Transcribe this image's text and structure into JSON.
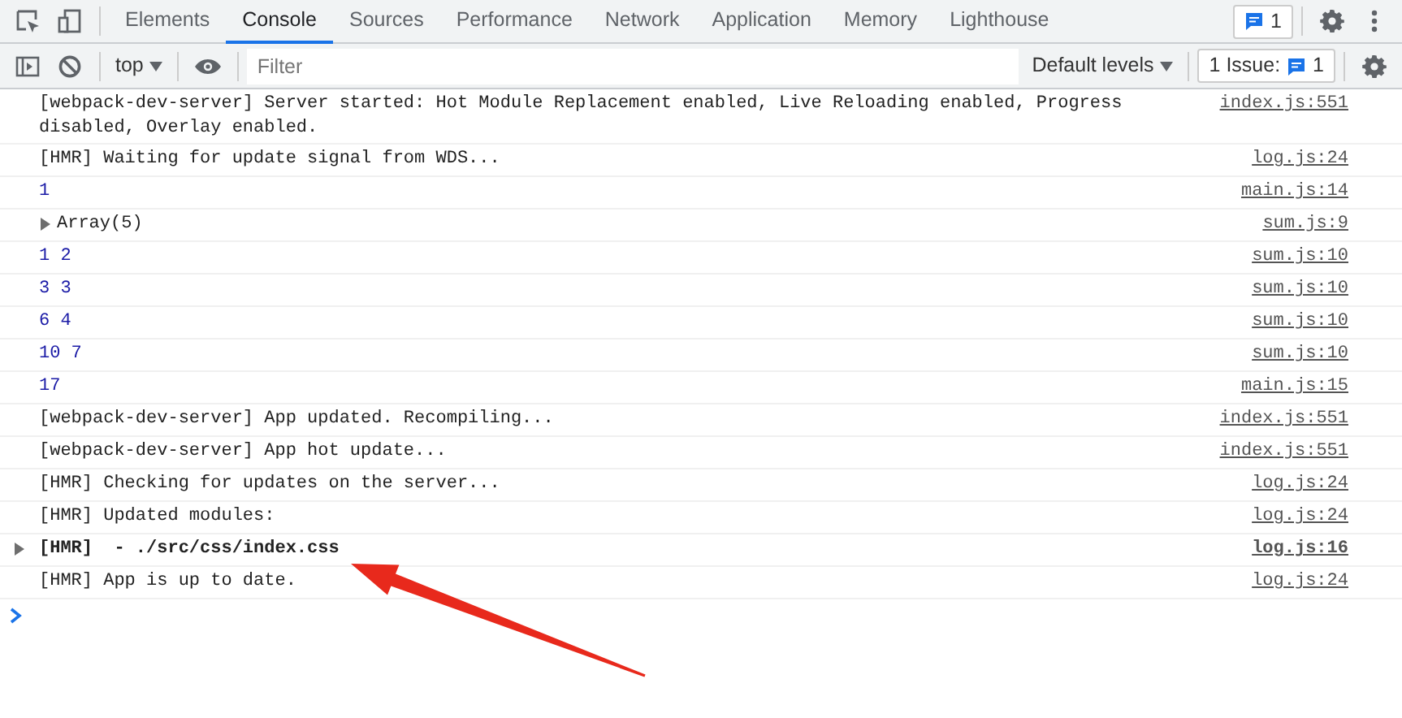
{
  "tabs": [
    {
      "label": "Elements",
      "selected": false
    },
    {
      "label": "Console",
      "selected": true
    },
    {
      "label": "Sources",
      "selected": false
    },
    {
      "label": "Performance",
      "selected": false
    },
    {
      "label": "Network",
      "selected": false
    },
    {
      "label": "Application",
      "selected": false
    },
    {
      "label": "Memory",
      "selected": false
    },
    {
      "label": "Lighthouse",
      "selected": false
    }
  ],
  "message_badge": {
    "count": "1"
  },
  "toolbar": {
    "context": "top",
    "filter": {
      "placeholder": "Filter"
    },
    "levels": "Default levels",
    "issues": {
      "label": "1 Issue:",
      "count": "1"
    }
  },
  "messages": [
    {
      "kind": "log",
      "text": "[webpack-dev-server] Server started: Hot Module Replacement enabled, Live Reloading enabled, Progress disabled, Overlay enabled.",
      "source": "index.js:551"
    },
    {
      "kind": "log",
      "text": "[HMR] Waiting for update signal from WDS...",
      "source": "log.js:24"
    },
    {
      "kind": "number",
      "text": "1",
      "source": "main.js:14"
    },
    {
      "kind": "object",
      "text": "Array(5)",
      "expanded": false,
      "source": "sum.js:9"
    },
    {
      "kind": "number",
      "text": "1 2",
      "source": "sum.js:10"
    },
    {
      "kind": "number",
      "text": "3 3",
      "source": "sum.js:10"
    },
    {
      "kind": "number",
      "text": "6 4",
      "source": "sum.js:10"
    },
    {
      "kind": "number",
      "text": "10 7",
      "source": "sum.js:10"
    },
    {
      "kind": "number",
      "text": "17",
      "source": "main.js:15"
    },
    {
      "kind": "log",
      "text": "[webpack-dev-server] App updated. Recompiling...",
      "source": "index.js:551"
    },
    {
      "kind": "log",
      "text": "[webpack-dev-server] App hot update...",
      "source": "index.js:551"
    },
    {
      "kind": "log",
      "text": "[HMR] Checking for updates on the server...",
      "source": "log.js:24"
    },
    {
      "kind": "log",
      "text": "[HMR] Updated modules:",
      "source": "log.js:24"
    },
    {
      "kind": "group",
      "text": "[HMR]  - ./src/css/index.css",
      "expanded": false,
      "source": "log.js:16"
    },
    {
      "kind": "log",
      "text": "[HMR] App is up to date.",
      "source": "log.js:24"
    }
  ]
}
